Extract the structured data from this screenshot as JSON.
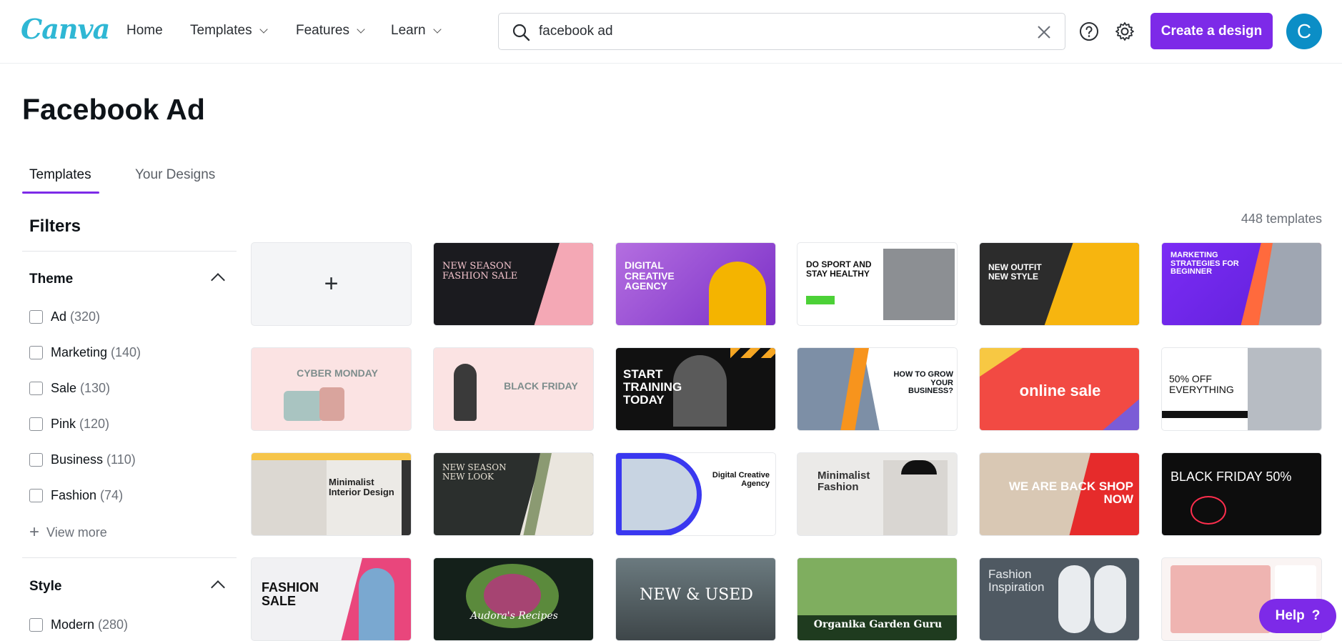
{
  "brand": {
    "logo": "Canva",
    "accent": "#7d2ae8"
  },
  "nav": {
    "home": "Home",
    "templates": "Templates",
    "features": "Features",
    "learn": "Learn"
  },
  "search": {
    "value": "facebook ad",
    "placeholder": "Search"
  },
  "header": {
    "create_label": "Create a design",
    "avatar_initial": "C"
  },
  "page": {
    "title": "Facebook Ad",
    "template_count": "448 templates"
  },
  "tabs": [
    {
      "label": "Templates"
    },
    {
      "label": "Your Designs"
    }
  ],
  "filters": {
    "title": "Filters",
    "theme": {
      "title": "Theme",
      "items": [
        {
          "label": "Ad",
          "count": "(320)"
        },
        {
          "label": "Marketing",
          "count": "(140)"
        },
        {
          "label": "Sale",
          "count": "(130)"
        },
        {
          "label": "Pink",
          "count": "(120)"
        },
        {
          "label": "Business",
          "count": "(110)"
        },
        {
          "label": "Fashion",
          "count": "(74)"
        }
      ],
      "view_more": "View more"
    },
    "style": {
      "title": "Style",
      "items": [
        {
          "label": "Modern",
          "count": "(280)"
        }
      ]
    }
  },
  "templates": [
    {
      "text": "NEW SEASON FASHION SALE"
    },
    {
      "text": "DIGITAL CREATIVE AGENCY"
    },
    {
      "text": "DO SPORT AND STAY HEALTHY"
    },
    {
      "text": "NEW OUTFIT NEW STYLE"
    },
    {
      "text": "MARKETING STRATEGIES FOR BEGINNER"
    },
    {
      "text": "CYBER MONDAY"
    },
    {
      "text": "BLACK FRIDAY"
    },
    {
      "text": "START TRAINING TODAY"
    },
    {
      "text": "HOW TO GROW YOUR BUSINESS?"
    },
    {
      "text": "online sale"
    },
    {
      "text": "50% OFF EVERYTHING"
    },
    {
      "text": "Minimalist Interior Design"
    },
    {
      "text": "NEW SEASON NEW LOOK"
    },
    {
      "text": "Digital Creative Agency"
    },
    {
      "text": "Minimalist Fashion"
    },
    {
      "text": "WE ARE BACK SHOP NOW"
    },
    {
      "text": "BLACK FRIDAY 50%"
    },
    {
      "text": "FASHION SALE"
    },
    {
      "text": "Audora's Recipes"
    },
    {
      "text": "NEW & USED"
    },
    {
      "text": "Organika Garden Guru"
    },
    {
      "text": "Fashion Inspiration"
    },
    {
      "text": ""
    }
  ],
  "help": {
    "label": "Help",
    "glyph": "?"
  }
}
